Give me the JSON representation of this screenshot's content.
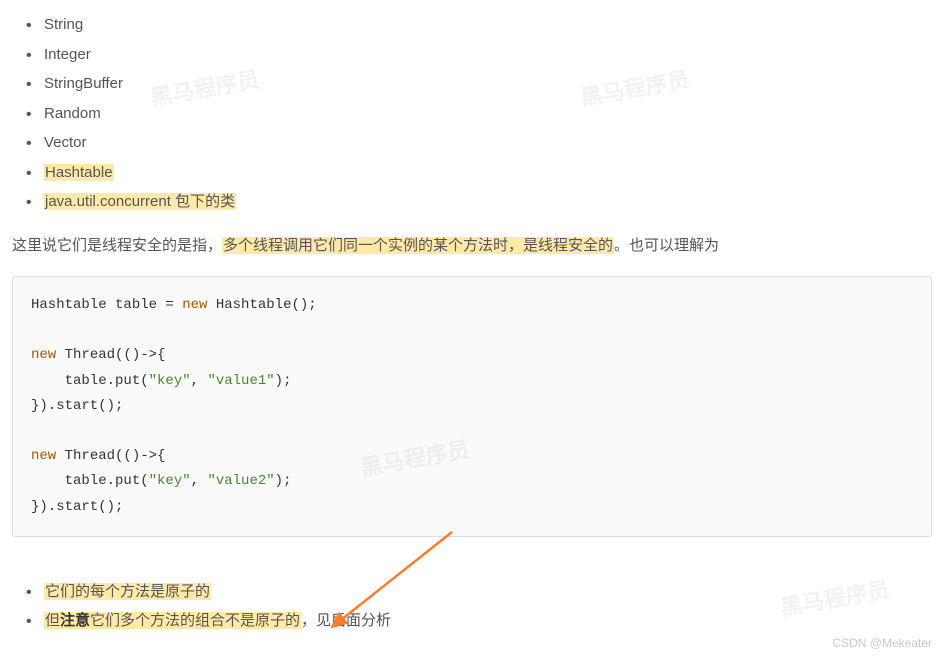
{
  "top_list": {
    "items": [
      {
        "text": "String",
        "highlight": false
      },
      {
        "text": "Integer",
        "highlight": false
      },
      {
        "text": "StringBuffer",
        "highlight": false
      },
      {
        "text": "Random",
        "highlight": false
      },
      {
        "text": "Vector",
        "highlight": false
      },
      {
        "text": "Hashtable",
        "highlight": true
      },
      {
        "text": "java.util.concurrent 包下的类",
        "highlight": true
      }
    ]
  },
  "paragraph": {
    "pre": "这里说它们是线程安全的是指，",
    "hl": "多个线程调用它们同一个实例的某个方法时，是线程安全的",
    "post": "。也可以理解为"
  },
  "code": {
    "line1_a": "Hashtable table = ",
    "line1_kw": "new",
    "line1_b": " Hashtable();",
    "blank": "",
    "line2_kw": "new",
    "line2_a": " Thread(()->{",
    "line3_a": "    table.put(",
    "line3_s1": "\"key\"",
    "line3_b": ", ",
    "line3_s2": "\"value1\"",
    "line3_c": ");",
    "line4_a": "}).start();",
    "line5_kw": "new",
    "line5_a": " Thread(()->{",
    "line6_a": "    table.put(",
    "line6_s1": "\"key\"",
    "line6_b": ", ",
    "line6_s2": "\"value2\"",
    "line6_c": ");",
    "line7_a": "}).start();"
  },
  "bottom_list": {
    "item1_hl": "它们的每个方法是原子的",
    "item2_pre": "但",
    "item2_bold": "注意",
    "item2_hl_rest": "它们多个方法的组合不是原子的",
    "item2_post": "，见后面分析"
  },
  "watermarks": {
    "wm": "黑马程序员"
  },
  "footer": "CSDN @Mekeater"
}
